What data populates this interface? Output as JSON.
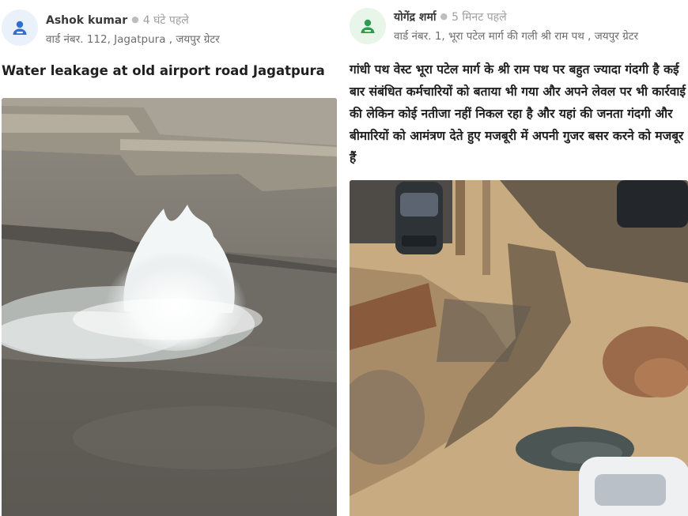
{
  "posts": [
    {
      "author": "Ashok kumar",
      "time": "4 घंटे पहले",
      "ward": "वार्ड नंबर. 112, Jagatpura , जयपुर ग्रेटर",
      "text": "Water leakage at old airport road Jagatpura",
      "avatar_icon": "person-icon",
      "avatar_color": "#2f6fd0"
    },
    {
      "author": "योगेंद्र शर्मा",
      "time": "5 मिनट पहले",
      "ward": "वार्ड नंबर. 1, भूरा पटेल मार्ग की गली श्री राम पथ , जयपुर ग्रेटर",
      "text": "गांधी पथ वेस्ट भूरा पटेल मार्ग के श्री राम पथ पर बहुत ज्यादा गंदगी है कई बार संबंधित कर्मचारियों को बताया भी गया और अपने लेवल पर भी कार्रवाई की लेकिन कोई नतीजा नहीं निकल रहा है और यहां की जनता गंदगी और बीमारियों को आमंत्रण देते हुए मजबूरी में अपनी गुजर बसर करने को मजबूर हैं",
      "avatar_icon": "person-icon",
      "avatar_color": "#2e9b4f"
    }
  ]
}
